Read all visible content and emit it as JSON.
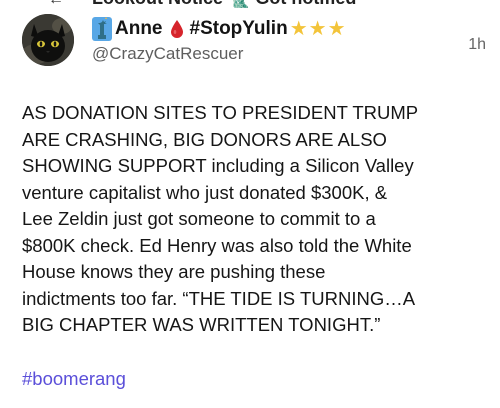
{
  "top_strip": {
    "text": "Lookout Notice 🗽 Got notified"
  },
  "post": {
    "display_name": "Anne",
    "hashtag_in_name": "#StopYulin",
    "handle": "@CrazyCatRescuer",
    "timestamp": "1h",
    "body": "AS DONATION SITES TO PRESIDENT TRUMP\nARE CRASHING, BIG DONORS ARE ALSO\nSHOWING SUPPORT including a Silicon Valley\nventure capitalist who just donated $300K, &\nLee Zeldin just got someone to commit to a\n$800K check. Ed Henry was also told the White\nHouse knows they are pushing these\nindictments too far. “THE TIDE IS TURNING…A\nBIG CHAPTER WAS WRITTEN TONIGHT.”",
    "hashtag": "#boomerang",
    "star_count": 3
  },
  "colors": {
    "link": "#5b4fd9",
    "handle": "#5e5e5e",
    "star": "#f3c43a",
    "drop": "#d6242b"
  },
  "icons": {
    "avatar": "black-cat-avatar",
    "name_prefix": "statue-of-liberty-icon",
    "name_drop": "blood-drop-icon",
    "name_suffix": "star-icon"
  }
}
